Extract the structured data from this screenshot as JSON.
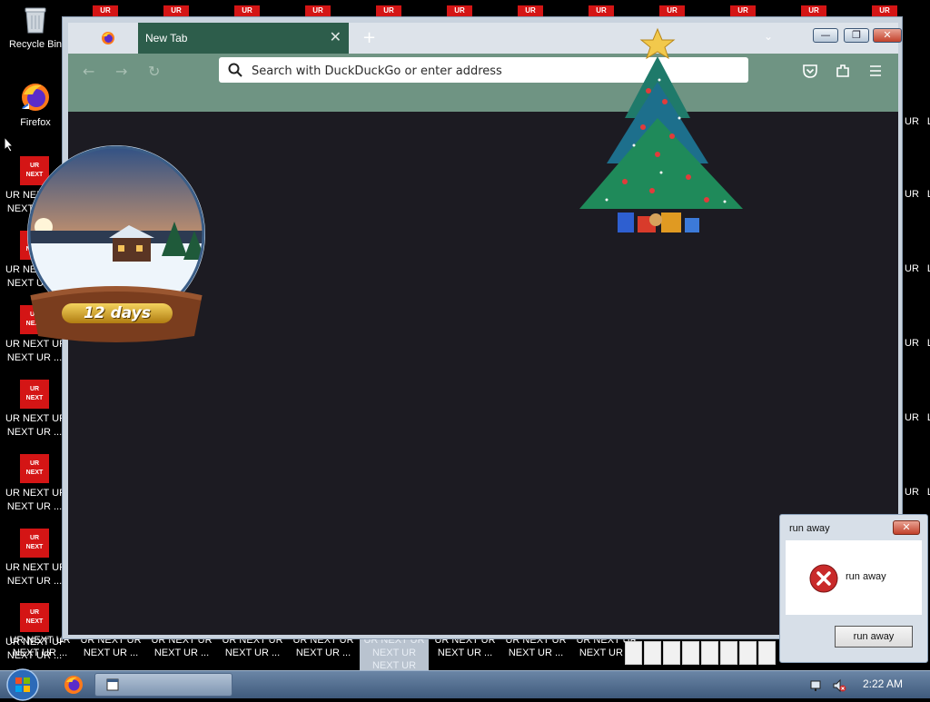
{
  "desktop": {
    "top_badge_text": "UR",
    "icons": {
      "recycle_bin": "Recycle Bin",
      "firefox": "Firefox"
    },
    "ur_icon_box": {
      "line1": "UR",
      "line2": "NEXT"
    },
    "ur_labels": [
      {
        "line1": "UR NEXT UR",
        "line2": "NEXT UR ..."
      },
      {
        "line1": "UR NEXT UR",
        "line2": "NEXT UR ..."
      },
      {
        "line1": "UR NEXT UR",
        "line2": "NEXT UR ..."
      },
      {
        "line1": "UR NEXT UR",
        "line2": "NEXT UR ..."
      },
      {
        "line1": "UR NEXT UR",
        "line2": "NEXT UR ..."
      },
      {
        "line1": "UR NEXT UR",
        "line2": "NEXT UR ..."
      },
      {
        "line1": "UR NEXT UR",
        "line2": "NEXT UR ..."
      }
    ],
    "right_col_text": "UR",
    "right_col_edge": "L",
    "bottom_row": [
      {
        "line1": "UR NEXT UR",
        "line2": "NEXT UR ..."
      },
      {
        "line1": "UR NEXT UR",
        "line2": "NEXT UR ..."
      },
      {
        "line1": "UR NEXT UR",
        "line2": "NEXT UR ..."
      },
      {
        "line1": "UR NEXT UR",
        "line2": "NEXT UR ..."
      },
      {
        "line1": "UR NEXT UR",
        "line2": "NEXT UR ..."
      },
      {
        "line1": "UR NEXT UR",
        "line2": "NEXT UR",
        "line3": "NEXT UR"
      },
      {
        "line1": "UR NEXT UR",
        "line2": "NEXT UR ..."
      },
      {
        "line1": "UR NEXT UR",
        "line2": "NEXT UR ..."
      },
      {
        "line1": "UR NEXT UR",
        "line2": "NEXT UR ..."
      }
    ]
  },
  "browser": {
    "tab_title": "New Tab",
    "tab_close": "✕",
    "new_tab": "+",
    "tab_list": "⌄",
    "search_placeholder": "Search with DuckDuckGo or enter address",
    "nav": {
      "back": "←",
      "forward": "→",
      "reload": "↻"
    },
    "window_buttons": {
      "minimize": "—",
      "maximize": "❐",
      "close": "✕"
    }
  },
  "snow_globe": {
    "label": "12 days"
  },
  "dialog": {
    "title": "run away",
    "message": "run away",
    "button": "run away",
    "close": "✕"
  },
  "taskbar": {
    "clock": "2:22 AM"
  },
  "colors": {
    "ur_red": "#d41515",
    "tab_green": "#2d5d4b",
    "toolbar_green": "#6f9483",
    "content_dark": "#1c1b22"
  }
}
